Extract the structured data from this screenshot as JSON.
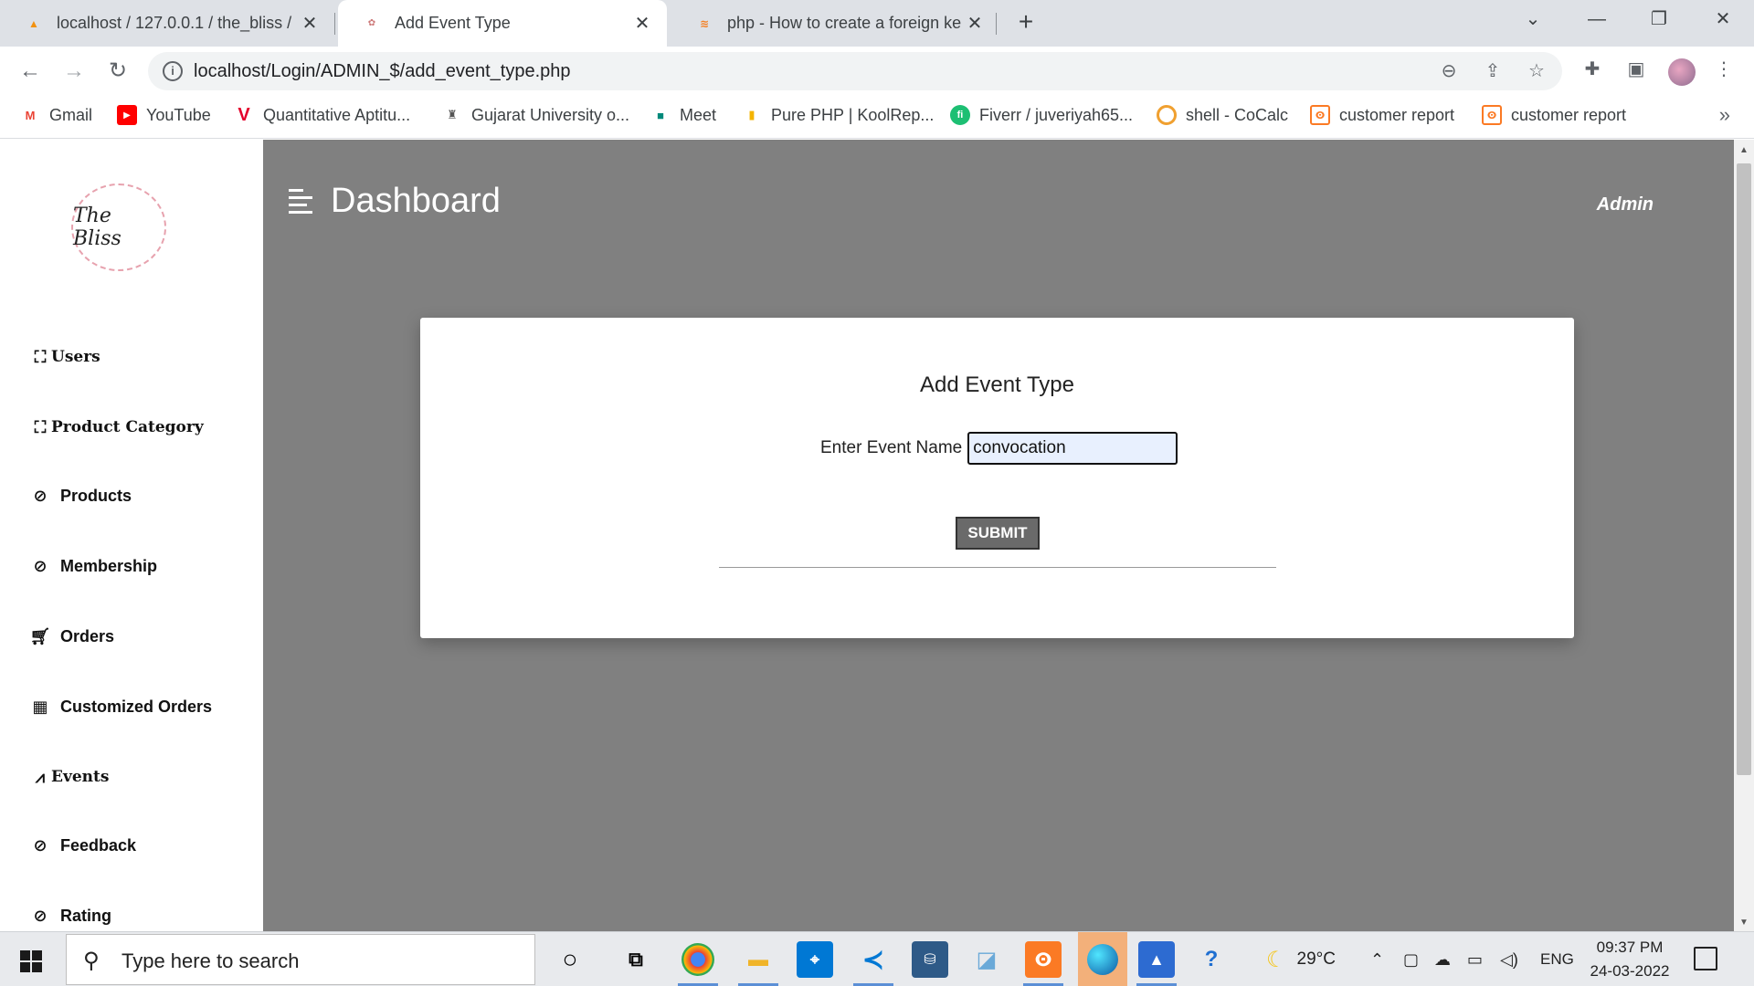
{
  "browser": {
    "tabs": [
      {
        "title": "localhost / 127.0.0.1 / the_bliss /",
        "icon": "phpmyadmin-icon",
        "active": false
      },
      {
        "title": "Add Event Type",
        "icon": "the-bliss-favicon",
        "active": true
      },
      {
        "title": "php - How to create a foreign ke",
        "icon": "stackoverflow-icon",
        "active": false
      }
    ],
    "url": "localhost/Login/ADMIN_$/add_event_type.php",
    "bookmarks": [
      {
        "label": "Gmail",
        "icon": "gmail-icon",
        "color": "#ea4335"
      },
      {
        "label": "YouTube",
        "icon": "youtube-icon",
        "color": "#ff0000"
      },
      {
        "label": "Quantitative Aptitu...",
        "icon": "v-logo-icon",
        "color": "#e4002b"
      },
      {
        "label": "Gujarat University o...",
        "icon": "university-icon",
        "color": "#555555"
      },
      {
        "label": "Meet",
        "icon": "meet-icon",
        "color": "#00897b"
      },
      {
        "label": "Pure PHP | KoolRep...",
        "icon": "chart-bars-icon",
        "color": "#f4b400"
      },
      {
        "label": "Fiverr / juveriyah65...",
        "icon": "fiverr-icon",
        "color": "#1dbf73"
      },
      {
        "label": "shell - CoCalc",
        "icon": "cocalc-icon",
        "color": "#f0a030"
      },
      {
        "label": "customer report",
        "icon": "xampp-icon",
        "color": "#fb7a24"
      },
      {
        "label": "customer report",
        "icon": "xampp-icon",
        "color": "#fb7a24"
      }
    ]
  },
  "sidebar": {
    "logo_text": "The Bliss",
    "items": [
      {
        "label": "Users",
        "icon": "sitemap-icon"
      },
      {
        "label": "Product Category",
        "icon": "sitemap-icon"
      },
      {
        "label": "Products",
        "icon": "paperclip-icon"
      },
      {
        "label": "Membership",
        "icon": "paperclip-icon"
      },
      {
        "label": "Orders",
        "icon": "cart-icon"
      },
      {
        "label": "Customized Orders",
        "icon": "gift-icon"
      },
      {
        "label": "Events",
        "icon": "line-chart-icon"
      },
      {
        "label": "Feedback",
        "icon": "paperclip-icon"
      },
      {
        "label": "Rating",
        "icon": "paperclip-icon"
      }
    ]
  },
  "header": {
    "title": "Dashboard",
    "user": "Admin"
  },
  "form": {
    "title": "Add Event Type",
    "field_label": "Enter Event Name",
    "field_value": "convocation",
    "submit_label": "SUBMIT"
  },
  "taskbar": {
    "search_placeholder": "Type here to search",
    "weather": "29°C",
    "language": "ENG",
    "time": "09:37 PM",
    "date": "24-03-2022"
  },
  "colors": {
    "main_bg": "#808080",
    "sidebar_bg": "#ffffff",
    "submit_bg": "#6a6a6a",
    "input_bg": "#e8f0fe"
  }
}
